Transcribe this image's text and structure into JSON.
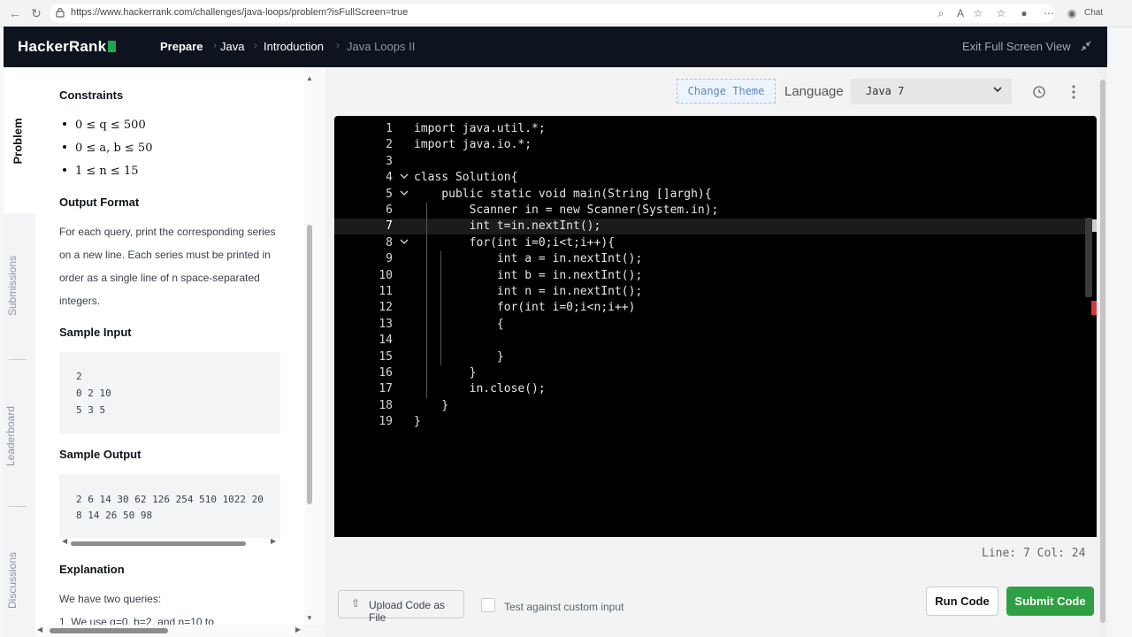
{
  "browser": {
    "url": "https://www.hackerrank.com/challenges/java-loops/problem?isFullScreen=true",
    "chat_label": "Chat"
  },
  "header": {
    "logo": "HackerRank",
    "breadcrumbs": [
      "Prepare",
      "Java",
      "Introduction",
      "Java Loops II"
    ],
    "exit_fullscreen": "Exit Full Screen View"
  },
  "tabs": [
    "Problem",
    "Submissions",
    "Leaderboard",
    "Discussions"
  ],
  "problem": {
    "constraints_title": "Constraints",
    "constraints": [
      "0 ≤ q ≤ 500",
      "0 ≤ a, b ≤ 50",
      "1 ≤ n ≤ 15"
    ],
    "output_title": "Output Format",
    "output_text": "For each query, print the corresponding series on a new line. Each series must be printed in order as a single line of n space-separated integers.",
    "sample_input_title": "Sample Input",
    "sample_input": [
      "2",
      "0 2 10",
      "5 3 5"
    ],
    "sample_output_title": "Sample Output",
    "sample_output": [
      "2 6 14 30 62 126 254 510 1022 20",
      "8 14 26 50 98"
    ],
    "explanation_title": "Explanation",
    "explanation_text": "We have two queries:",
    "explanation_cut": "1. We use q=0, b=2, and n=10 to"
  },
  "toolbar": {
    "change_theme": "Change Theme",
    "language_label": "Language",
    "language_value": "Java 7"
  },
  "editor": {
    "active_line": 7,
    "lines": [
      "import java.util.*;",
      "import java.io.*;",
      "",
      "class Solution{",
      "    public static void main(String []argh){",
      "        Scanner in = new Scanner(System.in);",
      "        int t=in.nextInt();",
      "        for(int i=0;i<t;i++){",
      "            int a = in.nextInt();",
      "            int b = in.nextInt();",
      "            int n = in.nextInt();",
      "            for(int i=0;i<n;i++)",
      "            {",
      "",
      "            }",
      "        }",
      "        in.close();",
      "    }",
      "}"
    ],
    "status": "Line: 7 Col: 24"
  },
  "bottom": {
    "upload": "Upload Code as File",
    "custom_input": "Test against custom input",
    "run": "Run Code",
    "submit": "Submit Code"
  }
}
